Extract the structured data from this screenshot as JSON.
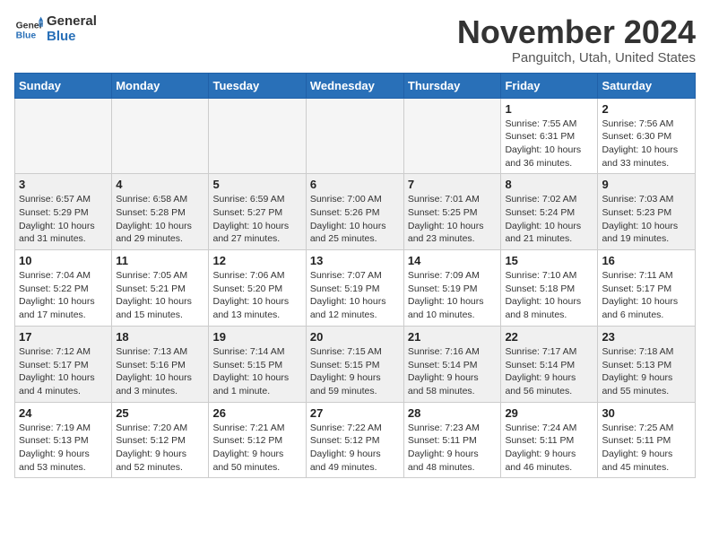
{
  "header": {
    "logo_general": "General",
    "logo_blue": "Blue",
    "month_title": "November 2024",
    "location": "Panguitch, Utah, United States"
  },
  "weekdays": [
    "Sunday",
    "Monday",
    "Tuesday",
    "Wednesday",
    "Thursday",
    "Friday",
    "Saturday"
  ],
  "weeks": [
    [
      {
        "day": "",
        "info": "",
        "empty": true
      },
      {
        "day": "",
        "info": "",
        "empty": true
      },
      {
        "day": "",
        "info": "",
        "empty": true
      },
      {
        "day": "",
        "info": "",
        "empty": true
      },
      {
        "day": "",
        "info": "",
        "empty": true
      },
      {
        "day": "1",
        "info": "Sunrise: 7:55 AM\nSunset: 6:31 PM\nDaylight: 10 hours\nand 36 minutes.",
        "empty": false
      },
      {
        "day": "2",
        "info": "Sunrise: 7:56 AM\nSunset: 6:30 PM\nDaylight: 10 hours\nand 33 minutes.",
        "empty": false
      }
    ],
    [
      {
        "day": "3",
        "info": "Sunrise: 6:57 AM\nSunset: 5:29 PM\nDaylight: 10 hours\nand 31 minutes.",
        "empty": false
      },
      {
        "day": "4",
        "info": "Sunrise: 6:58 AM\nSunset: 5:28 PM\nDaylight: 10 hours\nand 29 minutes.",
        "empty": false
      },
      {
        "day": "5",
        "info": "Sunrise: 6:59 AM\nSunset: 5:27 PM\nDaylight: 10 hours\nand 27 minutes.",
        "empty": false
      },
      {
        "day": "6",
        "info": "Sunrise: 7:00 AM\nSunset: 5:26 PM\nDaylight: 10 hours\nand 25 minutes.",
        "empty": false
      },
      {
        "day": "7",
        "info": "Sunrise: 7:01 AM\nSunset: 5:25 PM\nDaylight: 10 hours\nand 23 minutes.",
        "empty": false
      },
      {
        "day": "8",
        "info": "Sunrise: 7:02 AM\nSunset: 5:24 PM\nDaylight: 10 hours\nand 21 minutes.",
        "empty": false
      },
      {
        "day": "9",
        "info": "Sunrise: 7:03 AM\nSunset: 5:23 PM\nDaylight: 10 hours\nand 19 minutes.",
        "empty": false
      }
    ],
    [
      {
        "day": "10",
        "info": "Sunrise: 7:04 AM\nSunset: 5:22 PM\nDaylight: 10 hours\nand 17 minutes.",
        "empty": false
      },
      {
        "day": "11",
        "info": "Sunrise: 7:05 AM\nSunset: 5:21 PM\nDaylight: 10 hours\nand 15 minutes.",
        "empty": false
      },
      {
        "day": "12",
        "info": "Sunrise: 7:06 AM\nSunset: 5:20 PM\nDaylight: 10 hours\nand 13 minutes.",
        "empty": false
      },
      {
        "day": "13",
        "info": "Sunrise: 7:07 AM\nSunset: 5:19 PM\nDaylight: 10 hours\nand 12 minutes.",
        "empty": false
      },
      {
        "day": "14",
        "info": "Sunrise: 7:09 AM\nSunset: 5:19 PM\nDaylight: 10 hours\nand 10 minutes.",
        "empty": false
      },
      {
        "day": "15",
        "info": "Sunrise: 7:10 AM\nSunset: 5:18 PM\nDaylight: 10 hours\nand 8 minutes.",
        "empty": false
      },
      {
        "day": "16",
        "info": "Sunrise: 7:11 AM\nSunset: 5:17 PM\nDaylight: 10 hours\nand 6 minutes.",
        "empty": false
      }
    ],
    [
      {
        "day": "17",
        "info": "Sunrise: 7:12 AM\nSunset: 5:17 PM\nDaylight: 10 hours\nand 4 minutes.",
        "empty": false
      },
      {
        "day": "18",
        "info": "Sunrise: 7:13 AM\nSunset: 5:16 PM\nDaylight: 10 hours\nand 3 minutes.",
        "empty": false
      },
      {
        "day": "19",
        "info": "Sunrise: 7:14 AM\nSunset: 5:15 PM\nDaylight: 10 hours\nand 1 minute.",
        "empty": false
      },
      {
        "day": "20",
        "info": "Sunrise: 7:15 AM\nSunset: 5:15 PM\nDaylight: 9 hours\nand 59 minutes.",
        "empty": false
      },
      {
        "day": "21",
        "info": "Sunrise: 7:16 AM\nSunset: 5:14 PM\nDaylight: 9 hours\nand 58 minutes.",
        "empty": false
      },
      {
        "day": "22",
        "info": "Sunrise: 7:17 AM\nSunset: 5:14 PM\nDaylight: 9 hours\nand 56 minutes.",
        "empty": false
      },
      {
        "day": "23",
        "info": "Sunrise: 7:18 AM\nSunset: 5:13 PM\nDaylight: 9 hours\nand 55 minutes.",
        "empty": false
      }
    ],
    [
      {
        "day": "24",
        "info": "Sunrise: 7:19 AM\nSunset: 5:13 PM\nDaylight: 9 hours\nand 53 minutes.",
        "empty": false
      },
      {
        "day": "25",
        "info": "Sunrise: 7:20 AM\nSunset: 5:12 PM\nDaylight: 9 hours\nand 52 minutes.",
        "empty": false
      },
      {
        "day": "26",
        "info": "Sunrise: 7:21 AM\nSunset: 5:12 PM\nDaylight: 9 hours\nand 50 minutes.",
        "empty": false
      },
      {
        "day": "27",
        "info": "Sunrise: 7:22 AM\nSunset: 5:12 PM\nDaylight: 9 hours\nand 49 minutes.",
        "empty": false
      },
      {
        "day": "28",
        "info": "Sunrise: 7:23 AM\nSunset: 5:11 PM\nDaylight: 9 hours\nand 48 minutes.",
        "empty": false
      },
      {
        "day": "29",
        "info": "Sunrise: 7:24 AM\nSunset: 5:11 PM\nDaylight: 9 hours\nand 46 minutes.",
        "empty": false
      },
      {
        "day": "30",
        "info": "Sunrise: 7:25 AM\nSunset: 5:11 PM\nDaylight: 9 hours\nand 45 minutes.",
        "empty": false
      }
    ]
  ]
}
